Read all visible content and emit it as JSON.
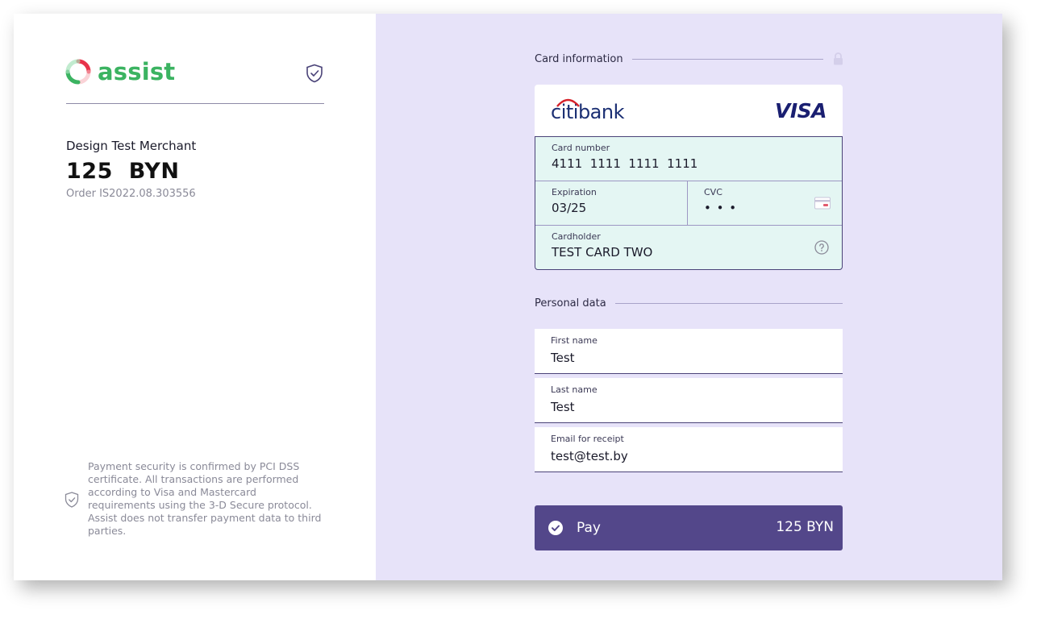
{
  "brand": {
    "name": "assist",
    "color": "#3bb361"
  },
  "order_summary": {
    "merchant": "Design Test Merchant",
    "amount": "125",
    "currency": "BYN",
    "order_label": "Order IS2022.08.303556"
  },
  "security_note": "Payment security is confirmed by PCI DSS certificate. All transactions are performed according to Visa and Mastercard requirements using the 3-D Secure protocol. Assist does not transfer payment data to third parties.",
  "card_section": {
    "title": "Card information",
    "bank_logo": "citibank",
    "network_logo": "VISA",
    "fields": {
      "card_number": {
        "label": "Card number",
        "value": "4111  1111  1111  1111"
      },
      "expiration": {
        "label": "Expiration",
        "value": "03/25"
      },
      "cvc": {
        "label": "CVC",
        "value": "• • •"
      },
      "cardholder": {
        "label": "Cardholder",
        "value": "TEST CARD TWO"
      }
    },
    "icons": [
      "lock-icon",
      "card-back-icon",
      "help-icon"
    ]
  },
  "personal_section": {
    "title": "Personal data",
    "fields": [
      {
        "label": "First name",
        "value": "Test"
      },
      {
        "label": "Last name",
        "value": "Test"
      },
      {
        "label": "Email for receipt",
        "value": "test@test.by"
      }
    ]
  },
  "pay_button": {
    "label": "Pay",
    "amount": "125 BYN",
    "color": "#53478a"
  },
  "colors": {
    "panel_bg": "#e7e3f9",
    "card_fields_bg": "#e4f6f3"
  }
}
